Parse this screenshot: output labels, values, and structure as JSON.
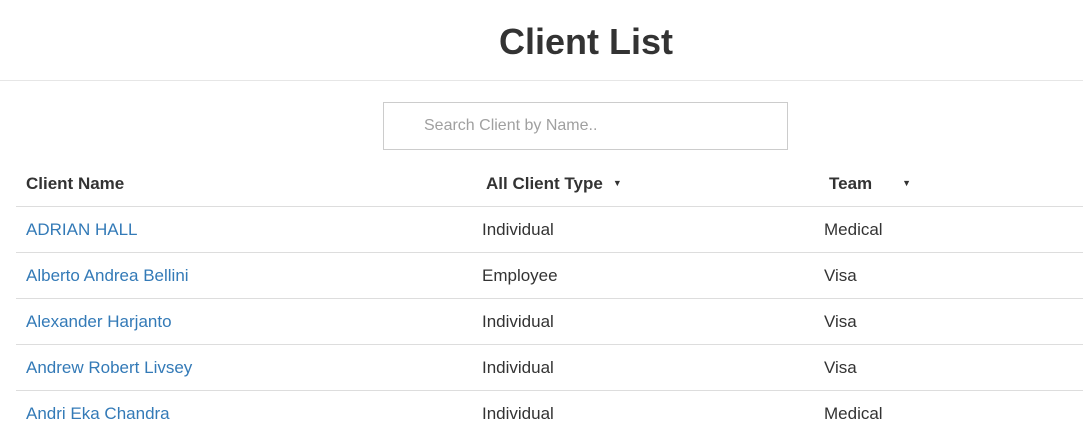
{
  "header": {
    "title": "Client List"
  },
  "search": {
    "placeholder": "Search Client by Name..",
    "value": ""
  },
  "table": {
    "columns": {
      "name": "Client Name",
      "type": "All Client Type",
      "team": "Team"
    },
    "dropdown_icon": "caret-down-icon",
    "rows": [
      {
        "name": "ADRIAN HALL",
        "type": "Individual",
        "team": "Medical"
      },
      {
        "name": "Alberto Andrea Bellini",
        "type": "Employee",
        "team": "Visa"
      },
      {
        "name": "Alexander Harjanto",
        "type": "Individual",
        "team": "Visa"
      },
      {
        "name": "Andrew Robert Livsey",
        "type": "Individual",
        "team": "Visa"
      },
      {
        "name": "Andri Eka Chandra",
        "type": "Individual",
        "team": "Medical"
      }
    ]
  },
  "colors": {
    "link": "#337ab7",
    "text": "#333333",
    "border": "#dddddd"
  }
}
